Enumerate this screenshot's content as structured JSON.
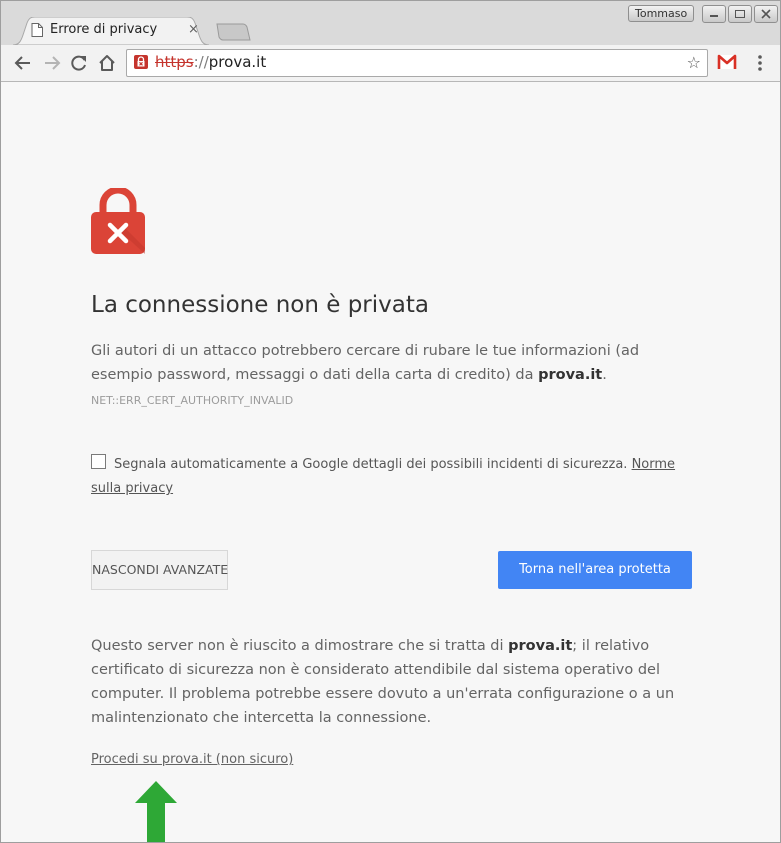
{
  "browser": {
    "tab_title": "Errore di privacy",
    "tab_close": "×",
    "profile_name": "Tommaso",
    "url_scheme": "https",
    "url_separator": "://",
    "url_host": "prova.it",
    "star": "☆"
  },
  "page": {
    "heading": "La connessione non è privata",
    "explanation_part1": "Gli autori di un attacco potrebbero cercare di rubare le tue informazioni (ad esempio password, messaggi o dati della carta di credito) da ",
    "explanation_domain": "prova.it",
    "explanation_end": ".",
    "error_code": "NET::ERR_CERT_AUTHORITY_INVALID",
    "report_label": "Segnala automaticamente a Google dettagli dei possibili incidenti di sicurezza.",
    "privacy_link": "Norme sulla privacy",
    "hide_advanced_button": "NASCONDI AVANZATE",
    "back_button": "Torna nell'area protetta",
    "details_part1": "Questo server non è riuscito a dimostrare che si tratta di ",
    "details_domain": "prova.it",
    "details_part2": "; il relativo certificato di sicurezza non è considerato attendibile dal sistema operativo del computer. Il problema potrebbe essere dovuto a un'errata configurazione o a un malintenzionato che intercetta la connessione.",
    "proceed_link": "Procedi su prova.it (non sicuro)"
  },
  "colors": {
    "error_red": "#db4437",
    "primary_blue": "#4285f4",
    "annotation_green": "#2ea836"
  },
  "icons": [
    "page-icon",
    "close-icon",
    "back-icon",
    "forward-icon",
    "reload-icon",
    "home-icon",
    "lock-broken-icon",
    "star-icon",
    "gmail-icon",
    "menu-icon",
    "padlock-error-icon",
    "arrow-up-icon"
  ]
}
